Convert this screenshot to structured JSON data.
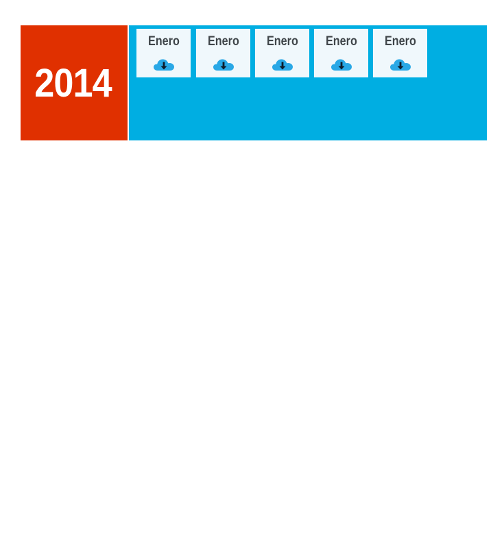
{
  "year": {
    "label": "2014",
    "color": "#e03000"
  },
  "panel": {
    "background": "#00aee2"
  },
  "months": [
    {
      "label": "Enero",
      "icon": "cloud-download-icon"
    },
    {
      "label": "Enero",
      "icon": "cloud-download-icon"
    },
    {
      "label": "Enero",
      "icon": "cloud-download-icon"
    },
    {
      "label": "Enero",
      "icon": "cloud-download-icon"
    },
    {
      "label": "Enero",
      "icon": "cloud-download-icon"
    }
  ],
  "colors": {
    "card_background": "#f0f8fc",
    "cloud": "#29a8e6",
    "arrow": "#0d1b2a",
    "label_text": "#3f4549"
  }
}
